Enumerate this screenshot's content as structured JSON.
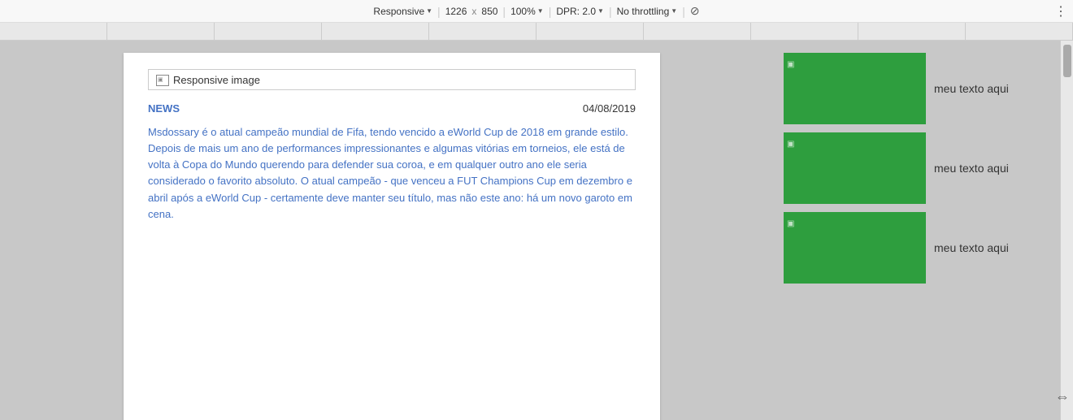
{
  "toolbar": {
    "responsive_label": "Responsive",
    "width": "1226",
    "x_separator": "x",
    "height": "850",
    "zoom": "100%",
    "dpr_label": "DPR: 2.0",
    "throttling_label": "No throttling",
    "more_options_icon": "⋮"
  },
  "page": {
    "responsive_image_alt": "Responsive image",
    "news_label": "NEWS",
    "news_date": "04/08/2019",
    "news_body": "Msdossary é o atual campeão mundial de Fifa, tendo vencido a eWorld Cup de 2018 em grande estilo. Depois de mais um ano de performances impressionantes e algumas vitórias em torneios, ele está de volta à Copa do Mundo querendo para defender sua coroa, e em qualquer outro ano ele seria considerado o favorito absoluto. O atual campeão - que venceu a FUT Champions Cup em dezembro e abril após a eWorld Cup - certamente deve manter seu título, mas não este ano: há um novo garoto em cena."
  },
  "cards": [
    {
      "text": "meu texto aqui"
    },
    {
      "text": "meu texto aqui"
    },
    {
      "text": "meu texto aqui"
    }
  ]
}
